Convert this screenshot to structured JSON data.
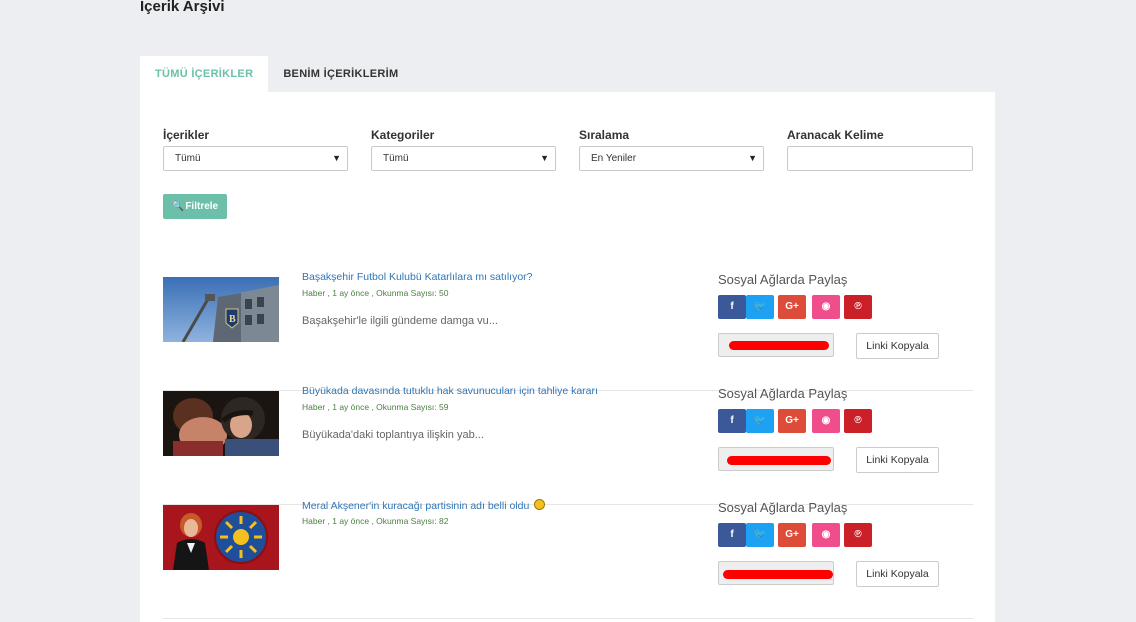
{
  "page": {
    "title": "İçerik Arşivi"
  },
  "tabs": [
    {
      "label": "TÜMÜ İÇERİKLER",
      "active": true
    },
    {
      "label": "BENİM İÇERİKLERİM",
      "active": false
    }
  ],
  "filters": {
    "contents": {
      "label": "İçerikler",
      "value": "Tümü"
    },
    "categories": {
      "label": "Kategoriler",
      "value": "Tümü"
    },
    "sorting": {
      "label": "Sıralama",
      "value": "En Yeniler"
    },
    "keyword": {
      "label": "Aranacak Kelime",
      "value": ""
    },
    "submit_label": "Filtrele"
  },
  "share": {
    "title": "Sosyal Ağlarda Paylaş",
    "copy_label": "Linki Kopyala",
    "buttons": [
      {
        "icon": "facebook-icon",
        "glyph": "f",
        "color": "#3b5998"
      },
      {
        "icon": "twitter-icon",
        "glyph": "🐦",
        "color": "#1da1f2"
      },
      {
        "icon": "google-plus-icon",
        "glyph": "G+",
        "color": "#dd4b39"
      },
      {
        "icon": "reddit-icon",
        "glyph": "◉",
        "color": "#ef4d8c"
      },
      {
        "icon": "pinterest-icon",
        "glyph": "℗",
        "color": "#cb2027"
      }
    ]
  },
  "articles": [
    {
      "title": "Başakşehir Futbol Kulubü Katarlılara mı satılıyor?",
      "meta": "Haber , 1 ay önce , Okunma Sayısı: 50",
      "excerpt": "Başakşehir'le ilgili gündeme damga vu..."
    },
    {
      "title": "Büyükada davasında tutuklu hak savunucuları için tahliye kararı",
      "meta": "Haber , 1 ay önce , Okunma Sayısı: 59",
      "excerpt": "Büyükada'daki toplantıya ilişkin yab..."
    },
    {
      "title": "Meral Akşener'in kuracağı partisinin adı belli oldu",
      "meta": "Haber , 1 ay önce , Okunma Sayısı: 82",
      "excerpt": ""
    }
  ]
}
